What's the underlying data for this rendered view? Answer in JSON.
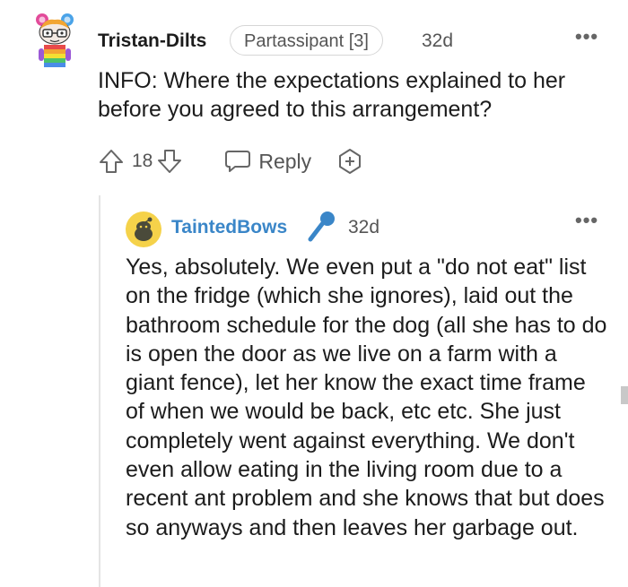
{
  "comment": {
    "username": "Tristan-Dilts",
    "flair": "Partassipant [3]",
    "time": "32d",
    "text": "INFO: Where the expectations explained to her before you agreed to this arrangement?",
    "score": "18",
    "reply_label": "Reply",
    "avatar_icon": "snoo-avatar-icon"
  },
  "reply": {
    "username": "TaintedBows",
    "time": "32d",
    "badge_icon": "microphone-icon",
    "text": "Yes, absolutely. We even put a \"do not eat\" list on the fridge (which she ignores), laid out the bathroom schedule for the dog (all she has to do is open the door as we live on a farm with a giant fence), let her know the exact time frame of when we would be back, etc etc. She just completely went against everything. We don't even allow eating in the living room due to a recent ant problem and she knows that but does so anyways and then leaves her garbage out.",
    "avatar_icon": "snoo-avatar-icon"
  },
  "colors": {
    "text": "#1c1c1c",
    "muted": "#555555",
    "username_link": "#3a86c8",
    "thread_line": "#e4e4e4",
    "mic_badge": "#3a86c8",
    "avatar_bg": "#f5d24a"
  }
}
